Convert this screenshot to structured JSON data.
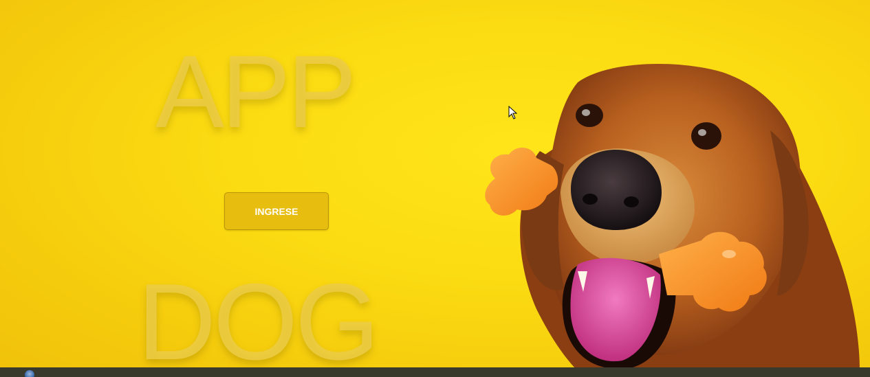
{
  "hero": {
    "title_top": "APP",
    "title_bottom": "DOG",
    "enter_button_label": "INGRESE"
  },
  "colors": {
    "background": "#fbdb12",
    "button": "#e7bd10",
    "title_text": "#eccd46",
    "taskbar": "#3a3a2c"
  },
  "icons": {
    "cursor": "mouse-pointer-icon",
    "start": "start-orb-icon"
  }
}
